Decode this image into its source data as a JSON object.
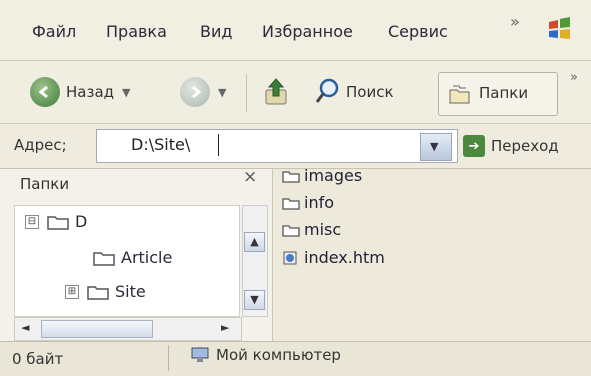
{
  "menu": {
    "file": "Файл",
    "edit": "Правка",
    "view": "Вид",
    "favorites": "Избранное",
    "tools": "Сервис",
    "more": "»"
  },
  "toolbar": {
    "back_label": "Назад",
    "search_label": "Поиск",
    "folders_label": "Папки",
    "more": "»"
  },
  "address": {
    "label": "Адрес;",
    "value": "D:\\Site\\",
    "go_label": "Переход"
  },
  "folders_pane": {
    "header": "Папки",
    "close": "×",
    "tree": [
      {
        "label": "D",
        "expander": "⊟"
      },
      {
        "label": "Article"
      },
      {
        "label": "Site",
        "expander": "⊞"
      }
    ]
  },
  "files": [
    "images",
    "info",
    "misc",
    "index.htm"
  ],
  "status": {
    "size": "0 байт",
    "location": "Мой компьютер"
  },
  "colors": {
    "folder": "#5a5a6a",
    "accent_green": "#4b8a3e"
  }
}
